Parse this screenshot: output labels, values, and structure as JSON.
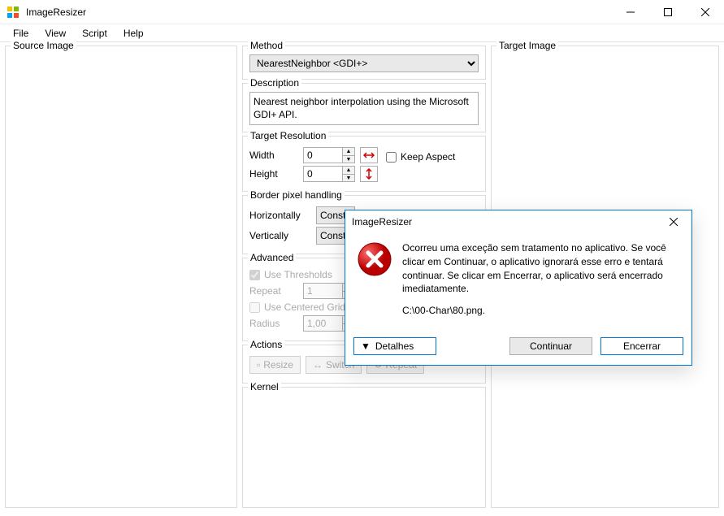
{
  "window": {
    "title": "ImageResizer",
    "menu": {
      "file": "File",
      "view": "View",
      "script": "Script",
      "help": "Help"
    }
  },
  "panels": {
    "source": "Source Image",
    "method": "Method",
    "description": "Description",
    "target_res": "Target Resolution",
    "border": "Border pixel handling",
    "advanced": "Advanced",
    "actions": "Actions",
    "kernel": "Kernel",
    "target": "Target Image"
  },
  "method": {
    "selected": "NearestNeighbor <GDI+>",
    "description": "Nearest neighbor interpolation using the Microsoft GDI+ API."
  },
  "resolution": {
    "width_label": "Width",
    "height_label": "Height",
    "width": "0",
    "height": "0",
    "keep_aspect_label": "Keep Aspect",
    "keep_aspect": false
  },
  "border": {
    "h_label": "Horizontally",
    "v_label": "Vertically",
    "h_value": "Consta",
    "v_value": "Consta"
  },
  "advanced": {
    "thresholds_label": "Use Thresholds",
    "thresholds_checked": true,
    "repeat_label": "Repeat",
    "repeat_value": "1",
    "centered_label": "Use Centered Grid",
    "centered_checked": false,
    "radius_label": "Radius",
    "radius_value": "1,00"
  },
  "actions": {
    "resize": "Resize",
    "switch": "Switch",
    "repeat": "Repeat"
  },
  "dialog": {
    "title": "ImageResizer",
    "message": "Ocorreu uma exceção sem tratamento no aplicativo. Se você clicar em Continuar, o aplicativo ignorará esse erro e tentará continuar. Se clicar em Encerrar, o aplicativo será encerrado imediatamente.",
    "path": "C:\\00-Char\\80.png.",
    "details": "Detalhes",
    "continue": "Continuar",
    "close": "Encerrar"
  }
}
